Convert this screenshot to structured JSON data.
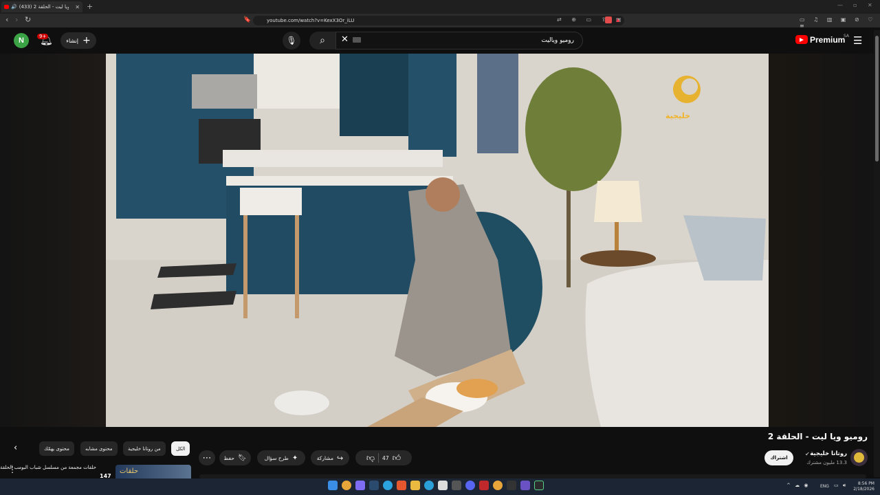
{
  "browser": {
    "tab_title": "(433) روميو ويا ليت - الحلقة 2",
    "url": "youtube.com/watch?v=KexX3Or_iLU"
  },
  "masthead": {
    "avatar_letter": "N",
    "notifications": "9+",
    "create_label": "إنشاء",
    "search_value": "روميو وياليت",
    "brand": "Premium",
    "region": "SA"
  },
  "video": {
    "title": "روميو ويا ليت - الحلقة 2",
    "channel": "روتانا خليجية",
    "subscribers": "13.3 مليون مشترك",
    "subscribe_label": "اشتراك",
    "likes": "47",
    "share_label": "مشاركة",
    "ask_label": "طرح سؤال",
    "save_label": "حفظ",
    "watermark": "خليجية"
  },
  "chips": [
    {
      "label": "الكل",
      "active": true
    },
    {
      "label": "من روتانا خليجية",
      "active": false
    },
    {
      "label": "محتوى مشابه",
      "active": false
    },
    {
      "label": "محتوى يهمّك",
      "active": false
    }
  ],
  "recommendation": {
    "title": "حلقات مجمعة من مسلسل شباب البومب الحلقة",
    "count": "147",
    "thumb_text": "حلقات"
  },
  "taskbar": {
    "lang": "ENG",
    "time": "8:56 PM",
    "date": "2/18/2026"
  },
  "colors": {
    "brand_red": "#ff0000",
    "avatar_green": "#3ba245",
    "background": "#0f0f0f",
    "pill": "#272727"
  }
}
